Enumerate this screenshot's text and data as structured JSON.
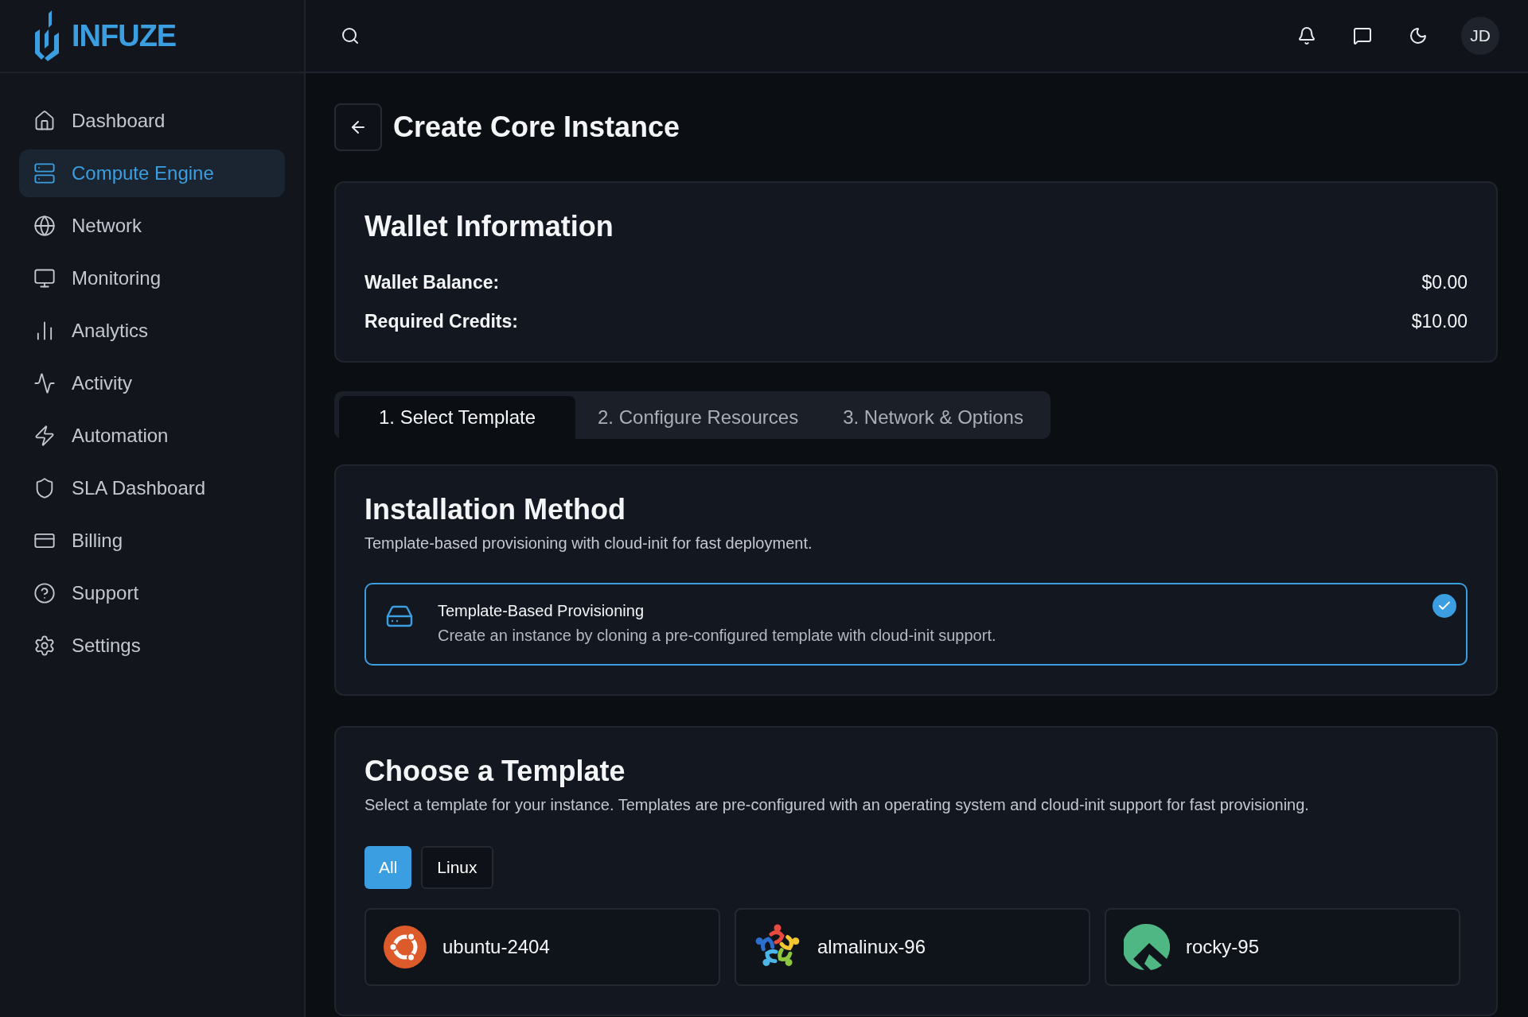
{
  "brand": {
    "name": "INFUZE"
  },
  "sidebar": {
    "items": [
      {
        "label": "Dashboard",
        "selected": false
      },
      {
        "label": "Compute Engine",
        "selected": true
      },
      {
        "label": "Network",
        "selected": false
      },
      {
        "label": "Monitoring",
        "selected": false
      },
      {
        "label": "Analytics",
        "selected": false
      },
      {
        "label": "Activity",
        "selected": false
      },
      {
        "label": "Automation",
        "selected": false
      },
      {
        "label": "SLA Dashboard",
        "selected": false
      },
      {
        "label": "Billing",
        "selected": false
      },
      {
        "label": "Support",
        "selected": false
      },
      {
        "label": "Settings",
        "selected": false
      }
    ]
  },
  "header": {
    "avatar": "JD"
  },
  "page": {
    "title": "Create Core Instance"
  },
  "wallet": {
    "title": "Wallet Information",
    "rows": [
      {
        "label": "Wallet Balance:",
        "value": "$0.00"
      },
      {
        "label": "Required Credits:",
        "value": "$10.00"
      }
    ]
  },
  "tabs": [
    {
      "label": "1. Select Template",
      "selected": true
    },
    {
      "label": "2. Configure Resources",
      "selected": false
    },
    {
      "label": "3. Network & Options",
      "selected": false
    }
  ],
  "installation": {
    "title": "Installation Method",
    "subtitle": "Template-based provisioning with cloud-init for fast deployment.",
    "options": [
      {
        "title": "Template-Based Provisioning",
        "description": "Create an instance by cloning a pre-configured template with cloud-init support.",
        "selected": true
      }
    ]
  },
  "templates": {
    "title": "Choose a Template",
    "subtitle": "Select a template for your instance. Templates are pre-configured with an operating system and cloud-init support for fast provisioning.",
    "filters": [
      {
        "label": "All",
        "selected": true
      },
      {
        "label": "Linux",
        "selected": false
      }
    ],
    "items": [
      {
        "name": "ubuntu-2404",
        "kind": "ubuntu"
      },
      {
        "name": "almalinux-96",
        "kind": "almalinux"
      },
      {
        "name": "rocky-95",
        "kind": "rocky"
      }
    ]
  }
}
